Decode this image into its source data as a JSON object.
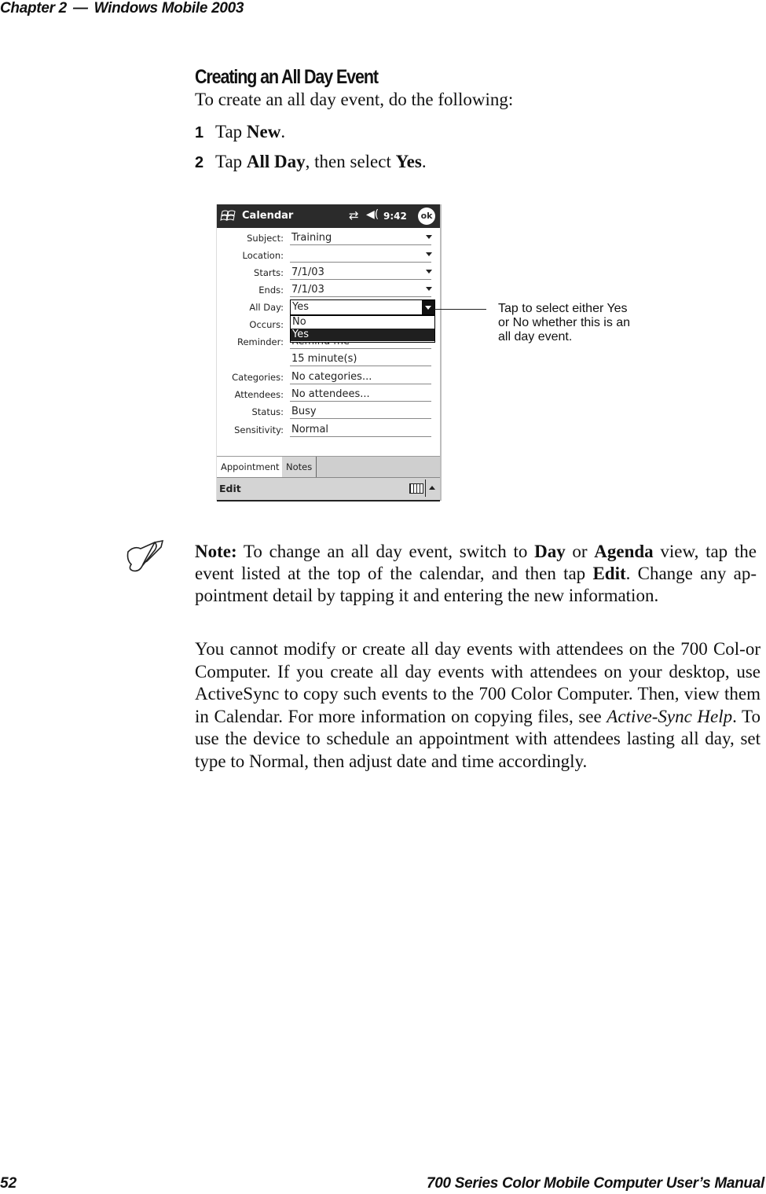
{
  "running_head": {
    "chapter": "Chapter 2",
    "dash": "—",
    "title": "Windows Mobile 2003"
  },
  "section": {
    "title": "Creating an All Day Event",
    "intro": "To create an all day event, do the following:",
    "steps": [
      {
        "num": "1",
        "pre": "Tap ",
        "bold": "New",
        "post": "."
      },
      {
        "num": "2",
        "pre": "Tap ",
        "bold": "All Day",
        "mid": ", then select ",
        "bold2": "Yes",
        "post": "."
      }
    ]
  },
  "device": {
    "titlebar": {
      "start_icon": "windows-flag-icon",
      "app": "Calendar",
      "connectivity_icon": "sync-arrows-icon",
      "volume_icon": "speaker-icon",
      "time": "9:42",
      "ok": "ok"
    },
    "fields": [
      {
        "label": "Subject:",
        "value": "Training",
        "dropdown": true
      },
      {
        "label": "Location:",
        "value": "",
        "dropdown": true
      },
      {
        "label": "Starts:",
        "value": "7/1/03",
        "dropdown": true
      },
      {
        "label": "Ends:",
        "value": "7/1/03",
        "dropdown": true
      },
      {
        "label": "All Day:",
        "value": "Yes",
        "dropdown": true
      },
      {
        "label": "Occurs:",
        "value": ""
      },
      {
        "label": "Reminder:",
        "value": "Remind me"
      },
      {
        "label": "",
        "value": "15   minute(s)"
      },
      {
        "label": "Categories:",
        "value": "No categories..."
      },
      {
        "label": "Attendees:",
        "value": "No attendees..."
      },
      {
        "label": "Status:",
        "value": "Busy"
      },
      {
        "label": "Sensitivity:",
        "value": "Normal"
      }
    ],
    "allday_options": [
      "No",
      "Yes"
    ],
    "allday_selected": "Yes",
    "tabs": [
      "Appointment",
      "Notes"
    ],
    "active_tab": "Appointment",
    "menu": {
      "edit": "Edit",
      "keyboard_icon": "keyboard-icon",
      "sip_icon": "up-arrow-icon"
    }
  },
  "callout": "Tap to select either Yes or No whether this is an all day event.",
  "note": {
    "label": "Note:",
    "t1": " To change an all day event, switch to ",
    "b1": "Day",
    "t2": " or ",
    "b2": "Agenda",
    "t3": " view, tap the event listed at the top of the calendar, and then tap ",
    "b3": "Edit",
    "t4": ". Change any ap-pointment detail by tapping it and entering the new information."
  },
  "paragraph": {
    "t1": "You cannot modify or create all day events with attendees on the 700 Col-or Computer. If you create all day events with attendees on your desktop, use ActiveSync to copy such events to the 700 Color Computer. Then, view them in Calendar. For more information on copying files, see ",
    "i1": "Active-Sync Help",
    "t2": ". To use the device to schedule an appointment with attendees lasting all day, set type to Normal, then adjust date and time accordingly."
  },
  "footer": {
    "page": "52",
    "book": "700 Series Color Mobile Computer User’s Manual"
  }
}
